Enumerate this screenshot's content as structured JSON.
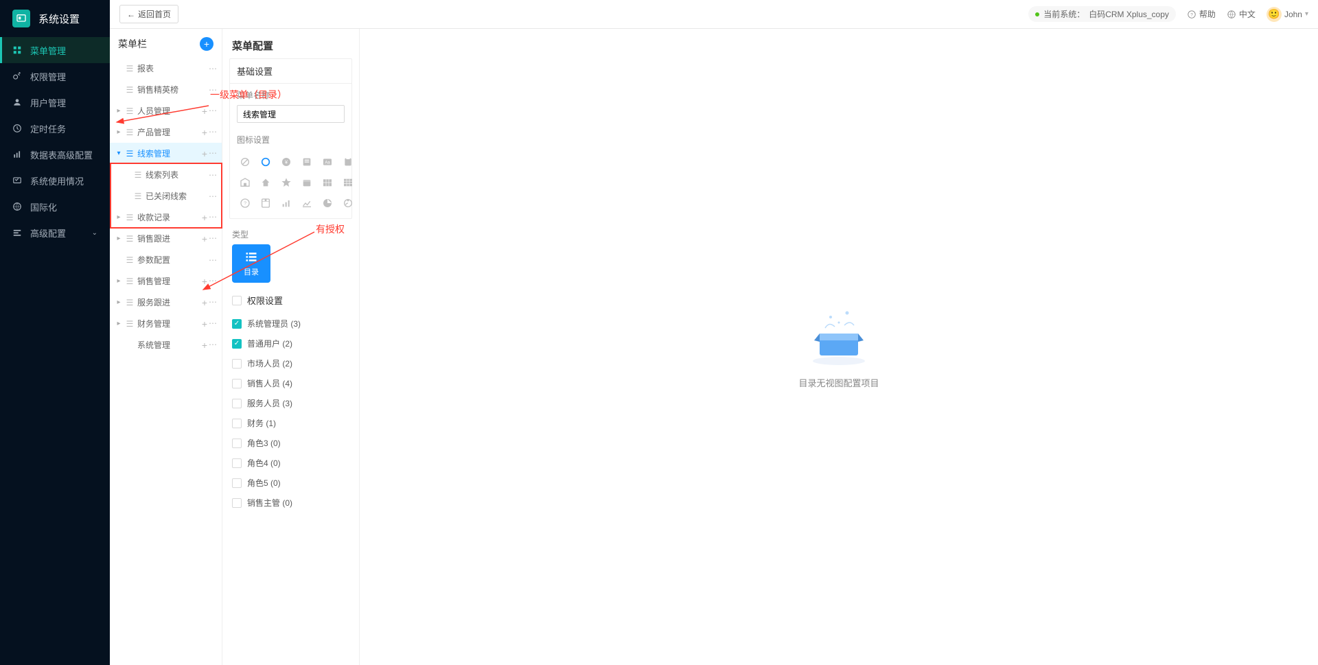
{
  "app_title": "系统设置",
  "sidebar": {
    "items": [
      {
        "label": "菜单管理",
        "active": true
      },
      {
        "label": "权限管理"
      },
      {
        "label": "用户管理"
      },
      {
        "label": "定时任务"
      },
      {
        "label": "数据表高级配置"
      },
      {
        "label": "系统使用情况"
      },
      {
        "label": "国际化"
      },
      {
        "label": "高级配置",
        "expandable": true
      }
    ]
  },
  "topbar": {
    "back_label": "返回首页",
    "current_system_label": "当前系统：",
    "current_system_value": "白码CRM Xplus_copy",
    "help_label": "帮助",
    "lang_label": "中文",
    "user_name": "John"
  },
  "menutree": {
    "title": "菜单栏",
    "items": [
      {
        "label": "报表",
        "leaf": true
      },
      {
        "label": "销售精英榜",
        "leaf": true
      },
      {
        "label": "人员管理"
      },
      {
        "label": "产品管理"
      },
      {
        "label": "线索管理",
        "selected": true,
        "children": [
          {
            "label": "线索列表"
          },
          {
            "label": "已关闭线索"
          }
        ]
      },
      {
        "label": "收款记录"
      },
      {
        "label": "销售跟进"
      },
      {
        "label": "参数配置",
        "leaf": true
      },
      {
        "label": "销售管理"
      },
      {
        "label": "服务跟进"
      },
      {
        "label": "财务管理"
      },
      {
        "label": "系统管理",
        "noicon": true
      }
    ]
  },
  "config": {
    "title": "菜单配置",
    "basic_section": "基础设置",
    "name_label": "菜单名称",
    "name_value": "线索管理",
    "icon_label": "图标设置",
    "type_label": "类型",
    "type_value": "目录",
    "perm_label": "权限设置",
    "permissions": [
      {
        "label": "系统管理员",
        "count": 3,
        "checked": true
      },
      {
        "label": "普通用户",
        "count": 2,
        "checked": true
      },
      {
        "label": "市场人员",
        "count": 2,
        "checked": false
      },
      {
        "label": "销售人员",
        "count": 4,
        "checked": false
      },
      {
        "label": "服务人员",
        "count": 3,
        "checked": false
      },
      {
        "label": "财务",
        "count": 1,
        "checked": false
      },
      {
        "label": "角色3",
        "count": 0,
        "checked": false
      },
      {
        "label": "角色4",
        "count": 0,
        "checked": false
      },
      {
        "label": "角色5",
        "count": 0,
        "checked": false
      },
      {
        "label": "销售主管",
        "count": 0,
        "checked": false
      }
    ]
  },
  "preview": {
    "empty_text": "目录无视图配置项目"
  },
  "annotations": {
    "a1": "一级菜单（目录）",
    "a2": "有授权"
  }
}
